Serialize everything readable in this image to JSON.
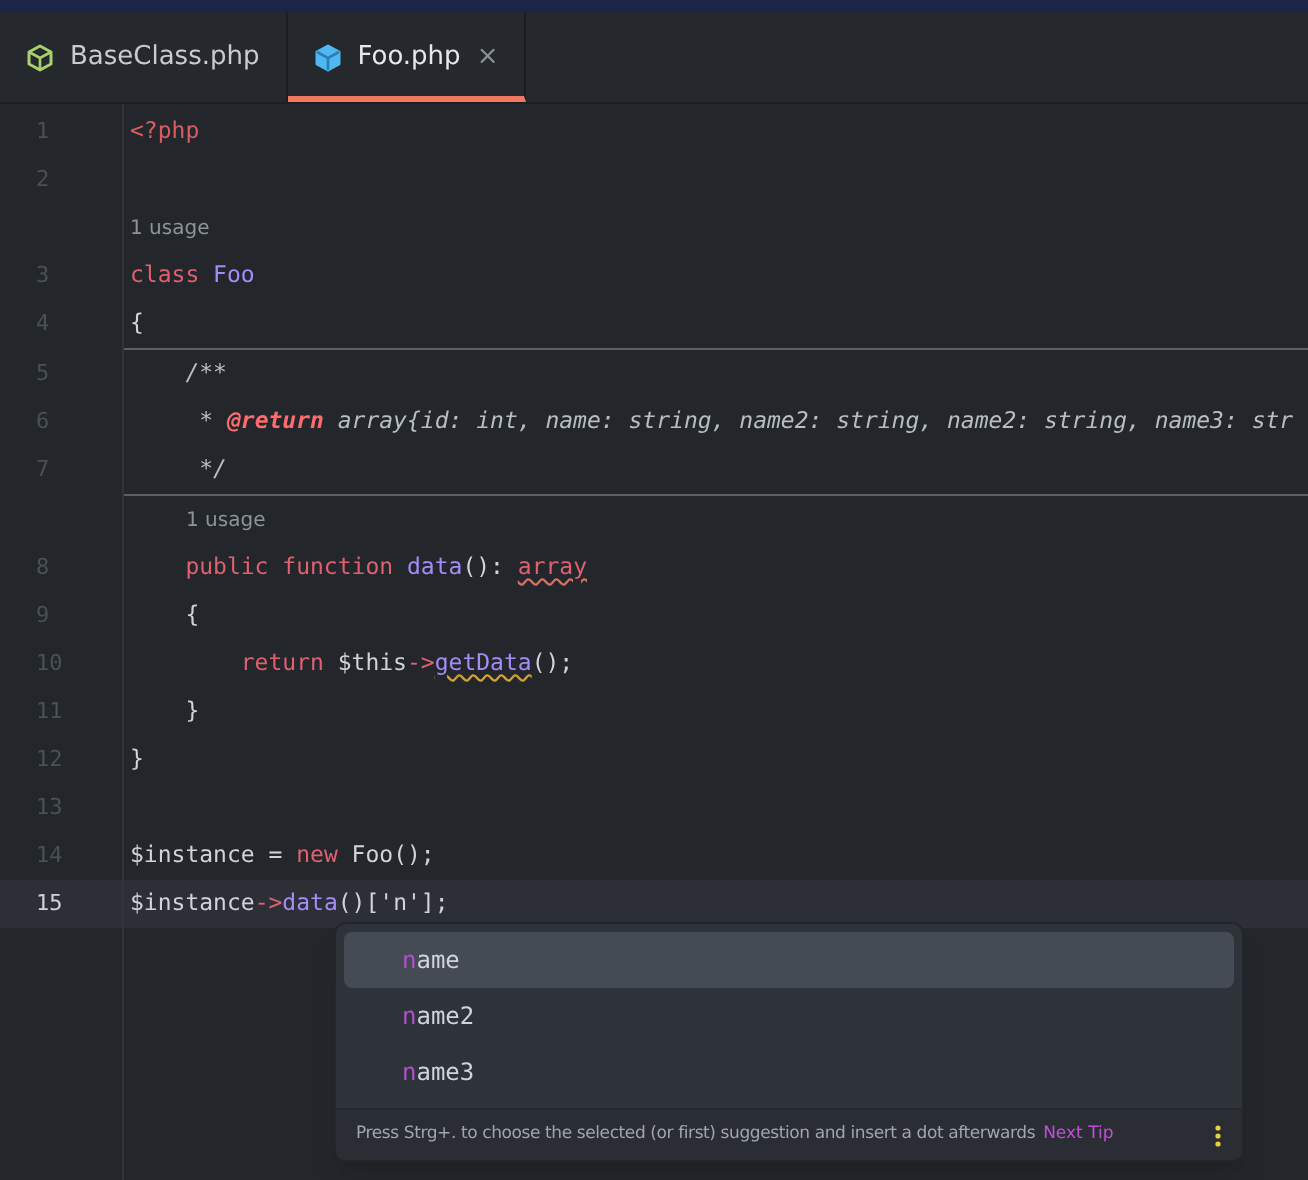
{
  "tabs": [
    {
      "label": "BaseClass.php",
      "selected": false
    },
    {
      "label": "Foo.php",
      "selected": true,
      "close": "×"
    }
  ],
  "editor": {
    "rows": [
      {
        "kind": "code",
        "number": "1",
        "current": false,
        "tokens": [
          {
            "kind": "tag",
            "text": "<?php"
          }
        ]
      },
      {
        "kind": "code",
        "number": "2",
        "current": false,
        "tokens": []
      },
      {
        "kind": "hint",
        "text": "1 usage"
      },
      {
        "kind": "code",
        "number": "3",
        "current": false,
        "tokens": [
          {
            "kind": "keyword",
            "text": "class "
          },
          {
            "kind": "name",
            "text": "Foo"
          }
        ]
      },
      {
        "kind": "code",
        "number": "4",
        "current": false,
        "tokens": [
          {
            "kind": "plain",
            "text": "{"
          }
        ]
      },
      {
        "kind": "doc",
        "lines": [
          {
            "kind": "code",
            "number": "5",
            "current": false,
            "tokens": [
              {
                "kind": "comment",
                "text": "    /**"
              }
            ]
          },
          {
            "kind": "code",
            "number": "6",
            "current": false,
            "tokens": [
              {
                "kind": "comment",
                "text": "     * "
              },
              {
                "kind": "doctag",
                "text": "@return"
              },
              {
                "kind": "comment",
                "text": " array{id: int, name: string, name2: string, name2: string, name3: str"
              }
            ]
          },
          {
            "kind": "code",
            "number": "7",
            "current": false,
            "tokens": [
              {
                "kind": "comment",
                "text": "     */"
              }
            ]
          }
        ]
      },
      {
        "kind": "memberhint",
        "text": "1 usage"
      },
      {
        "kind": "code",
        "number": "8",
        "current": false,
        "tokens": [
          {
            "kind": "keyword",
            "text": "    public function "
          },
          {
            "kind": "name",
            "text": "data"
          },
          {
            "kind": "plain",
            "text": "(): "
          },
          {
            "kind": "warnkeyword",
            "text": "array"
          }
        ]
      },
      {
        "kind": "code",
        "number": "9",
        "current": false,
        "tokens": [
          {
            "kind": "plain",
            "text": "    {"
          }
        ]
      },
      {
        "kind": "code",
        "number": "10",
        "current": false,
        "tokens": [
          {
            "kind": "keyword",
            "text": "        return "
          },
          {
            "kind": "plain",
            "text": "$this"
          },
          {
            "kind": "keyword",
            "text": "->"
          },
          {
            "kind": "warnmethod",
            "text": "getData"
          },
          {
            "kind": "plain",
            "text": "();"
          }
        ]
      },
      {
        "kind": "code",
        "number": "11",
        "current": false,
        "tokens": [
          {
            "kind": "plain",
            "text": "    }"
          }
        ]
      },
      {
        "kind": "code",
        "number": "12",
        "current": false,
        "tokens": [
          {
            "kind": "plain",
            "text": "}"
          }
        ]
      },
      {
        "kind": "code",
        "number": "13",
        "current": false,
        "tokens": []
      },
      {
        "kind": "code",
        "number": "14",
        "current": false,
        "tokens": [
          {
            "kind": "plain",
            "text": "$instance = "
          },
          {
            "kind": "keyword",
            "text": "new "
          },
          {
            "kind": "plain",
            "text": "Foo();"
          }
        ]
      },
      {
        "kind": "code",
        "number": "15",
        "current": true,
        "tokens": [
          {
            "kind": "plain",
            "text": "$instance"
          },
          {
            "kind": "keyword",
            "text": "->"
          },
          {
            "kind": "name",
            "text": "data"
          },
          {
            "kind": "plain",
            "text": "()['n'];"
          }
        ]
      }
    ]
  },
  "completion": {
    "items": [
      {
        "match": "n",
        "rest": "ame",
        "selected": true
      },
      {
        "match": "n",
        "rest": "ame2",
        "selected": false
      },
      {
        "match": "n",
        "rest": "ame3",
        "selected": false
      }
    ],
    "tip": "Press Strg+. to choose the selected (or first) suggestion and insert a dot afterwards",
    "next_tip": "Next Tip"
  }
}
